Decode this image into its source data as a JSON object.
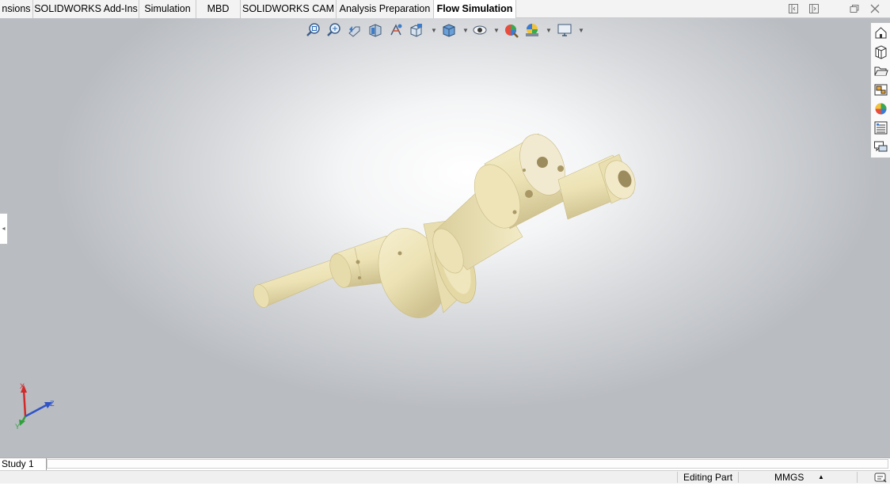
{
  "tabs": [
    {
      "label": "nsions",
      "active": false
    },
    {
      "label": "SOLIDWORKS Add-Ins",
      "active": false
    },
    {
      "label": "Simulation",
      "active": false
    },
    {
      "label": "MBD",
      "active": false
    },
    {
      "label": "SOLIDWORKS CAM",
      "active": false
    },
    {
      "label": "Analysis Preparation",
      "active": false
    },
    {
      "label": "Flow Simulation",
      "active": true
    }
  ],
  "window_controls": [
    "tile-left-icon",
    "tile-right-icon",
    "restore-icon",
    "close-icon"
  ],
  "heads_up_toolbar": [
    "zoom-to-fit-icon",
    "zoom-to-area-icon",
    "previous-view-icon",
    "section-view-icon",
    "dynamic-annotation-icon",
    "view-orientation-icon",
    "display-style-icon",
    "hide-show-items-icon",
    "edit-appearance-icon",
    "apply-scene-icon",
    "view-settings-icon"
  ],
  "task_pane": [
    "solidworks-resources-icon",
    "design-library-icon",
    "file-explorer-icon",
    "view-palette-icon",
    "appearances-scenes-icon",
    "custom-properties-icon",
    "forum-icon"
  ],
  "triad": {
    "x": "X",
    "y": "Y",
    "z": "Z"
  },
  "bottom": {
    "study_tab": "Study 1"
  },
  "status": {
    "mode": "Editing Part",
    "units": "MMGS",
    "units_arrow": "▲"
  },
  "colors": {
    "part": "#efe6bd",
    "part_shade": "#d8cd9a",
    "viewport_center": "#ffffff",
    "viewport_edge": "#b9bcc1"
  }
}
